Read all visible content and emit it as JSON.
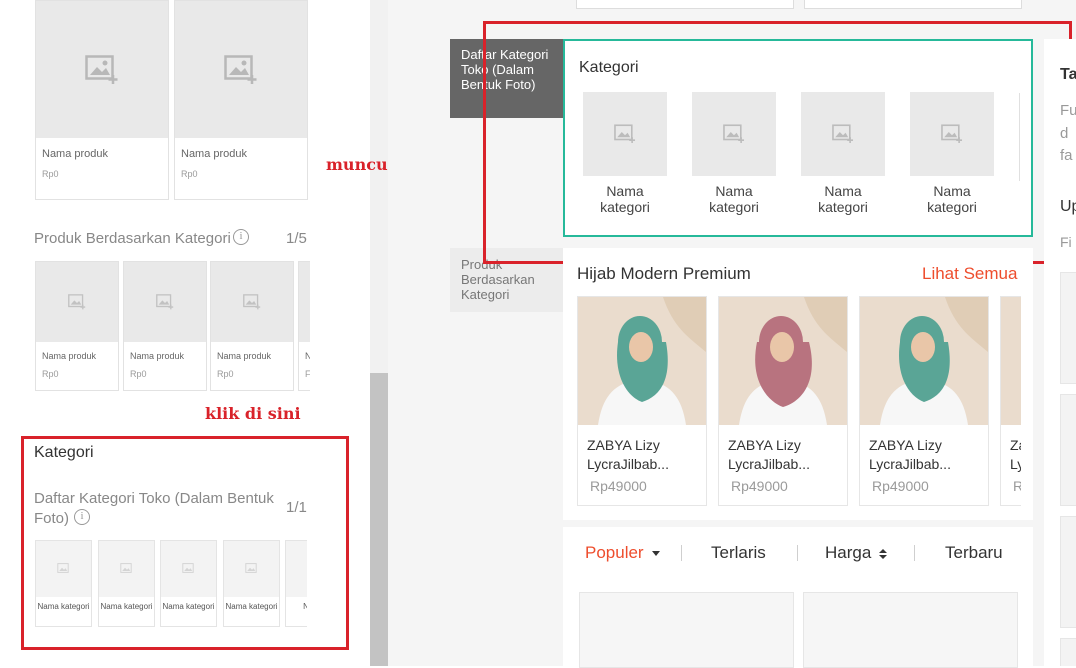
{
  "left_panel": {
    "top_products": [
      {
        "name": "Nama produk",
        "price": "Rp0"
      },
      {
        "name": "Nama produk",
        "price": "Rp0"
      }
    ],
    "category_products_section": {
      "title": "Produk Berdasarkan Kategori",
      "page": "1/5",
      "products": [
        {
          "name": "Nama produk",
          "price": "Rp0"
        },
        {
          "name": "Nama produk",
          "price": "Rp0"
        },
        {
          "name": "Nama produk",
          "price": "Rp0"
        },
        {
          "name": "N",
          "price": "F"
        }
      ]
    },
    "annotation_click": "klik di sini",
    "kategori_section": {
      "heading": "Kategori",
      "subtitle": "Daftar Kategori Toko (Dalam Bentuk Foto)",
      "page": "1/1",
      "tiles": [
        "Nama kategori",
        "Nama kategori",
        "Nama kategori",
        "Nama kategori",
        "N"
      ]
    }
  },
  "annotation_appears": "muncul ini",
  "side_labels": {
    "active": "Daftar Kategori Toko (Dalam Bentuk Foto)",
    "inactive": "Produk Berdasarkan Kategori"
  },
  "preview": {
    "kategori_heading": "Kategori",
    "kategori_tiles": [
      "Nama kategori",
      "Nama kategori",
      "Nama kategori",
      "Nama kategori"
    ],
    "hijab_section": {
      "title": "Hijab Modern Premium",
      "see_all": "Lihat Semua",
      "products": [
        {
          "name": "ZABYA Lizy LycraJilbab...",
          "price": "Rp49000",
          "scarf_color": "#5aa596"
        },
        {
          "name": "ZABYA Lizy LycraJilbab...",
          "price": "Rp49000",
          "scarf_color": "#b8737f"
        },
        {
          "name": "ZABYA Lizy LycraJilbab...",
          "price": "Rp49000",
          "scarf_color": "#5aa596"
        },
        {
          "name": "Za Ly",
          "price": "R",
          "scarf_color": "#5aa596"
        }
      ]
    },
    "sort_tabs": [
      "Populer",
      "Terlaris",
      "Harga",
      "Terbaru"
    ]
  },
  "right_edge": {
    "heading": "Ta",
    "text_lines": [
      "Fu",
      "d",
      "fa"
    ],
    "heading2": "Up",
    "text2": "Fi"
  },
  "colors": {
    "accent": "#ee4d2d",
    "annotation_red": "#d9222a",
    "teal": "#26b99a"
  }
}
